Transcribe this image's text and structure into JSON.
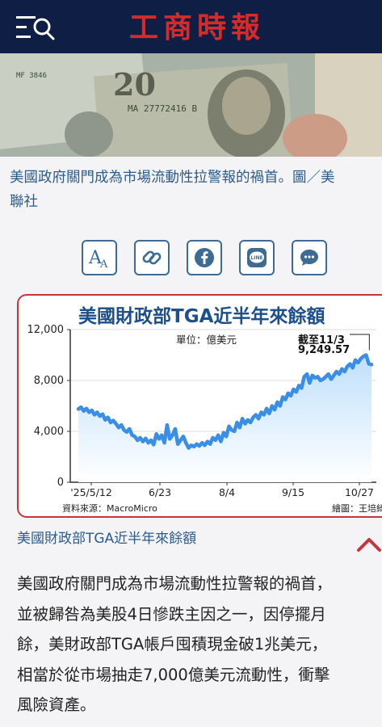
{
  "header": {
    "logo_text": "工商時報",
    "menu_icon": "menu-search-icon"
  },
  "hero": {
    "image_alt": "banknotes-photo"
  },
  "image_caption": {
    "line1": "美國政府關門成為市場流動性拉警報的禍首。圖／美",
    "line2": "聯社"
  },
  "share_buttons": [
    {
      "name": "font-size-icon"
    },
    {
      "name": "copy-link-icon"
    },
    {
      "name": "facebook-icon"
    },
    {
      "name": "line-icon",
      "label": "LINE"
    },
    {
      "name": "comment-icon"
    }
  ],
  "chart": {
    "caption": "美國財政部TGA近半年來餘額"
  },
  "chart_data": {
    "type": "area",
    "title": "美國財政部TGA近半年來餘額",
    "unit_label": "單位：億美元",
    "y_ticks": [
      "0",
      "4,000",
      "8,000",
      "12,000"
    ],
    "ylim": [
      0,
      12000
    ],
    "x_ticks": [
      "'25/5/12",
      "6/23",
      "8/4",
      "9/15",
      "10/27"
    ],
    "annotation_line1": "截至11/3",
    "annotation_line2": "9,249.57",
    "source": "資料來源：MacroMicro",
    "credit": "繪圖：王培綺",
    "series": [
      {
        "values": [
          5750,
          5900,
          5600,
          5800,
          5500,
          5650,
          5300,
          5500,
          5200,
          5350,
          4900,
          5100,
          4700,
          4850,
          4600,
          4300,
          4500,
          4100,
          3950,
          4200,
          3700,
          3600,
          3300,
          3500,
          3200,
          3450,
          3100,
          3300,
          2950,
          3800,
          3400,
          3700,
          3100,
          4500,
          3400,
          3700,
          4200,
          3000,
          3300,
          3600,
          3100,
          2700,
          2900,
          2800,
          3000,
          2850,
          3100,
          2900,
          3200,
          3000,
          3500,
          3300,
          3700,
          3200,
          3900,
          3600,
          4400,
          4100,
          4000,
          4700,
          4300,
          5000,
          4600,
          4900,
          4700,
          5100,
          5300,
          5000,
          5500,
          5300,
          5800,
          5400,
          6000,
          5700,
          6300,
          6000,
          6700,
          6500,
          7000,
          6800,
          7300,
          7100,
          7600,
          7400,
          8300,
          8500,
          7800,
          8400,
          8200,
          8300,
          8000,
          8100,
          8300,
          8500,
          8100,
          8400,
          8700,
          8500,
          8900,
          8700,
          9100,
          9300,
          9000,
          9600,
          9400,
          9700,
          9900,
          10000,
          9300,
          9249.57
        ]
      }
    ]
  },
  "body": {
    "lines": [
      "美國政府關門成為市場流動性拉警報的禍首，",
      "並被歸咎為美股4日慘跌主因之一，因停擺月",
      "餘，美財政部TGA帳戶囤積現金破1兆美元，",
      "相當於從市場抽走7,000億美元流動性，衝擊",
      "風險資產。"
    ]
  },
  "colors": {
    "header_bg": "#0e1e45",
    "logo": "#d52b2b",
    "link_blue": "#2c5b8a",
    "chart_line": "#3a8ee6",
    "chart_title": "#1c4f8c",
    "card_border": "#c9343a"
  }
}
